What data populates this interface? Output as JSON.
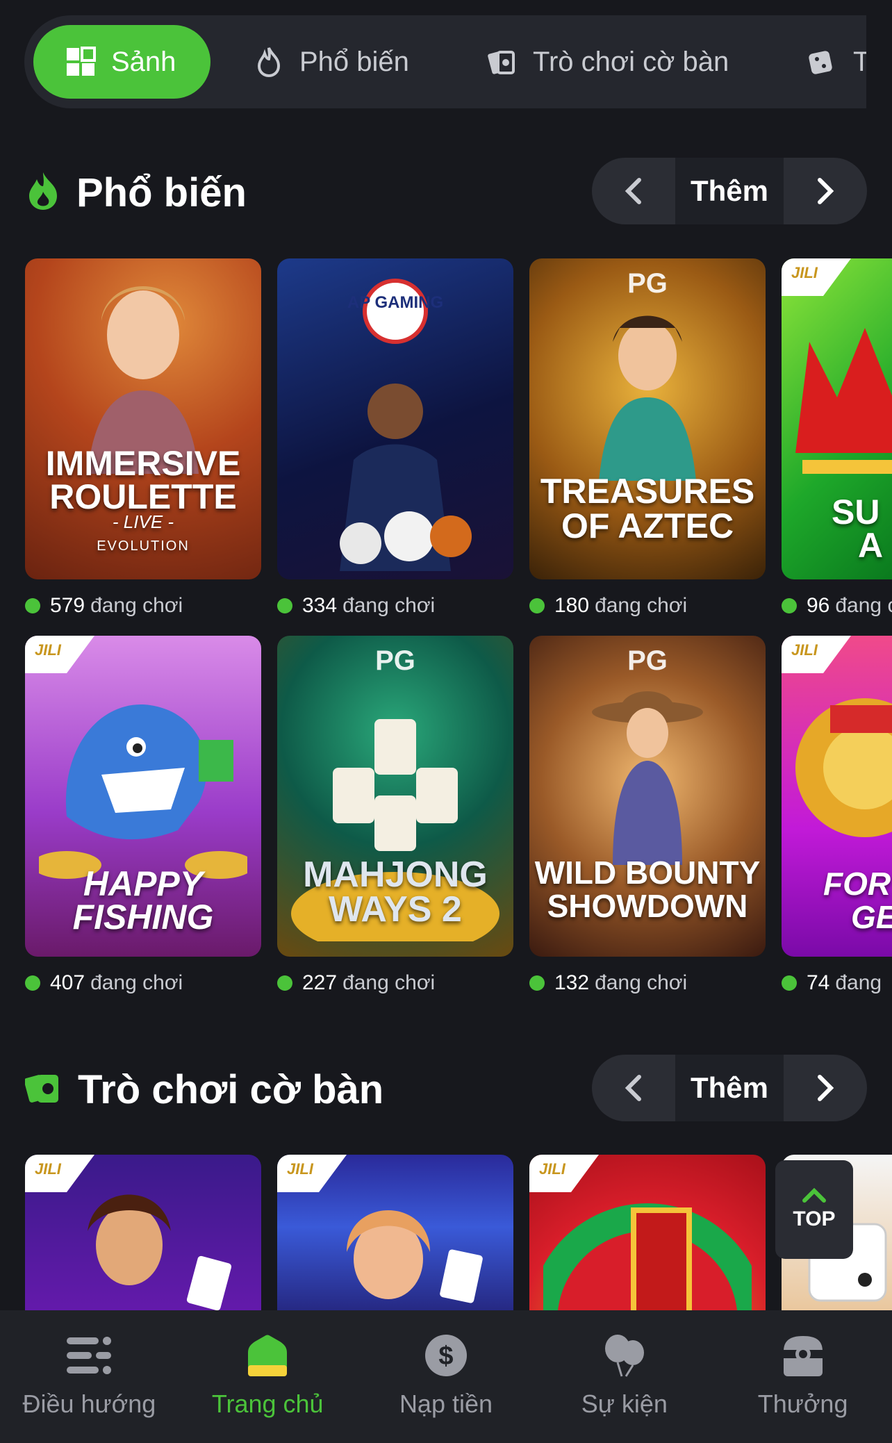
{
  "tabs": [
    {
      "label": "Sảnh",
      "icon": "grid-icon",
      "active": true
    },
    {
      "label": "Phổ biến",
      "icon": "flame-icon"
    },
    {
      "label": "Trò chơi cờ bàn",
      "icon": "cards-icon"
    },
    {
      "label": "T",
      "icon": "dice-icon"
    }
  ],
  "sections": {
    "popular": {
      "title": "Phổ biến",
      "more_label": "Thêm"
    },
    "board": {
      "title": "Trò chơi cờ bàn",
      "more_label": "Thêm"
    }
  },
  "popular_games": [
    {
      "title_lines": [
        "IMMERSIVE",
        "ROULETTE"
      ],
      "sub": "- LIVE -",
      "provider": "EVOLUTION",
      "players": "579",
      "suffix": "đang chơi"
    },
    {
      "title_lines": [],
      "provider": "AP GAMING",
      "players": "334",
      "suffix": "đang chơi"
    },
    {
      "title_lines": [
        "TREASURES",
        "OF AZTEC"
      ],
      "provider": "PG",
      "players": "180",
      "suffix": "đang chơi"
    },
    {
      "title_lines": [
        "SU",
        "A"
      ],
      "provider": "JILI",
      "players": "96",
      "suffix": "đang c"
    },
    {
      "title_lines": [
        "HAPPY",
        "FISHING"
      ],
      "provider": "JILI",
      "players": "407",
      "suffix": "đang chơi"
    },
    {
      "title_lines": [
        "MAHJONG",
        "WAYS 2"
      ],
      "provider": "PG",
      "players": "227",
      "suffix": "đang chơi"
    },
    {
      "title_lines": [
        "WILD BOUNTY",
        "SHOWDOWN"
      ],
      "provider": "PG",
      "players": "132",
      "suffix": "đang chơi"
    },
    {
      "title_lines": [
        "FOR",
        "GE"
      ],
      "provider": "JILI",
      "players": "74",
      "suffix": "đang"
    }
  ],
  "board_games": [
    {
      "provider": "JILI"
    },
    {
      "provider": "JILI"
    },
    {
      "provider": "JILI"
    },
    {
      "provider": ""
    }
  ],
  "top_button": "TOP",
  "bottom_nav": [
    {
      "label": "Điều hướng",
      "icon": "menu-icon"
    },
    {
      "label": "Trang chủ",
      "icon": "home-icon",
      "active": true
    },
    {
      "label": "Nạp tiền",
      "icon": "dollar-icon"
    },
    {
      "label": "Sự kiện",
      "icon": "balloons-icon"
    },
    {
      "label": "Thưởng",
      "icon": "gift-icon"
    }
  ],
  "colors": {
    "accent": "#4bc33a",
    "background": "#17181d"
  }
}
